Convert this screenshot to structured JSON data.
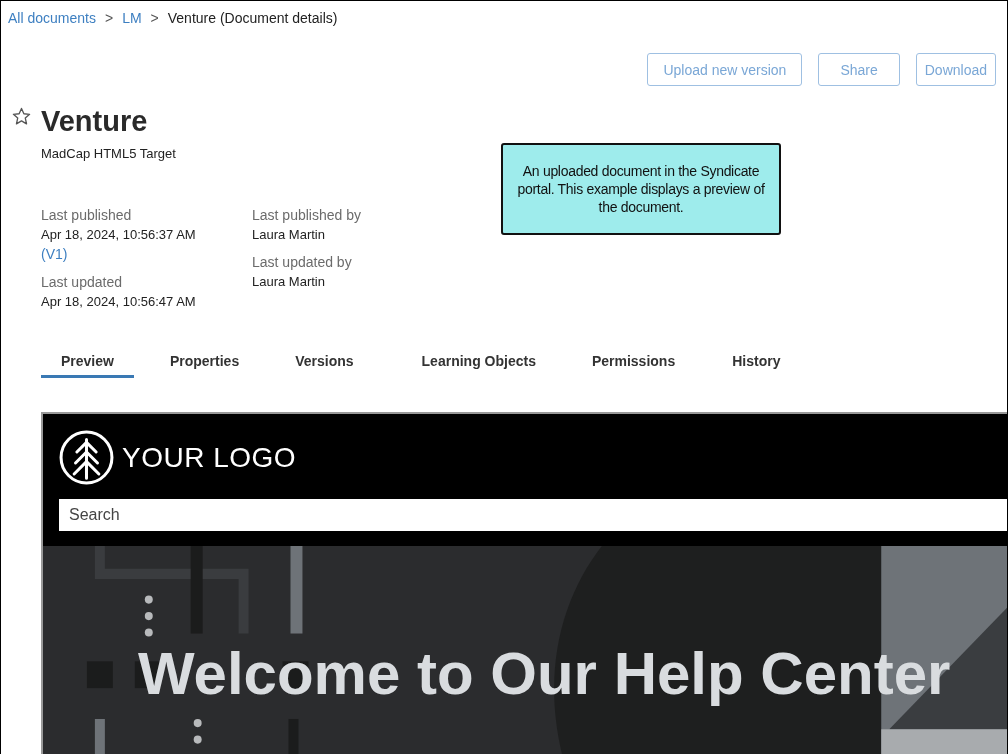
{
  "breadcrumb": [
    {
      "label": "All documents",
      "kind": "link"
    },
    {
      "label": ">",
      "kind": "separator"
    },
    {
      "label": "LM",
      "kind": "link"
    },
    {
      "label": ">",
      "kind": "separator"
    },
    {
      "label": "Venture (Document details)",
      "kind": "current"
    }
  ],
  "actions": [
    "Upload new version",
    "Share",
    "Download"
  ],
  "document": {
    "title": "Venture",
    "starred": false,
    "subtitle": "MadCap HTML5 Target"
  },
  "meta_columns": [
    [
      {
        "label": "Last published",
        "value": "Apr 18, 2024, 10:56:37 AM",
        "version": "(V1)"
      },
      {
        "label": "Last updated",
        "value": "Apr 18, 2024, 10:56:47 AM"
      }
    ],
    [
      {
        "label": "Last published by",
        "value": "Laura Martin"
      },
      {
        "label": "Last updated by",
        "value": "Laura Martin"
      }
    ]
  ],
  "callout": "An uploaded document in the Syndicate portal. This example displays a preview of the document.",
  "tabs": [
    {
      "label": "Preview",
      "selected": true
    },
    {
      "label": "Properties",
      "selected": false
    },
    {
      "label": "Versions",
      "selected": false
    },
    {
      "label": "Learning Objects",
      "selected": false
    },
    {
      "label": "Permissions",
      "selected": false
    },
    {
      "label": "History",
      "selected": false
    }
  ],
  "preview": {
    "logo_text": "YOUR LOGO",
    "search_placeholder": "Search",
    "heading": "Welcome to Our Help Center"
  }
}
